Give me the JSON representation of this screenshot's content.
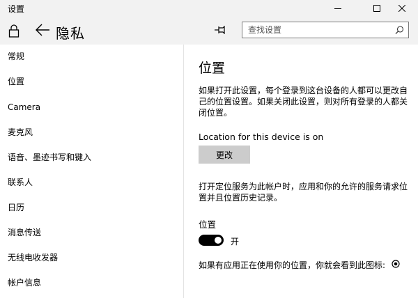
{
  "window": {
    "title": "设置",
    "minimize_icon": "minimize-icon",
    "maximize_icon": "maximize-icon",
    "close_icon": "close-icon"
  },
  "header": {
    "title": "隐私",
    "search_placeholder": "查找设置",
    "icons": [
      "lock-icon",
      "back-arrow-icon",
      "pin-icon",
      "search-icon"
    ]
  },
  "sidebar": {
    "items": [
      {
        "label": "常规"
      },
      {
        "label": "位置"
      },
      {
        "label": "Camera"
      },
      {
        "label": "麦克风"
      },
      {
        "label": "语音、墨迹书写和键入"
      },
      {
        "label": "联系人"
      },
      {
        "label": "日历"
      },
      {
        "label": "消息传送"
      },
      {
        "label": "无线电收发器"
      },
      {
        "label": "帐户信息"
      }
    ]
  },
  "main": {
    "title": "位置",
    "description": "如果打开此设置，每个登录到这台设备的人都可以更改自己的位置设置。如果关闭此设置，则对所有登录的人都关闭位置。",
    "device_status": "Location for this device is on",
    "change_button": "更改",
    "service_description": "打开定位服务为此帐户时，应用和你的允许的服务请求位置并且位置历史记录。",
    "toggle_label": "位置",
    "toggle_on": true,
    "toggle_state_text": "开",
    "in_use_note": "如果有应用正在使用你的位置，你就会看到此图标:",
    "in_use_icon": "location-in-use-icon"
  },
  "colors": {
    "title_bar_bg": "#f2f2f2",
    "button_bg": "#cccccc",
    "toggle_on": "#000000"
  }
}
